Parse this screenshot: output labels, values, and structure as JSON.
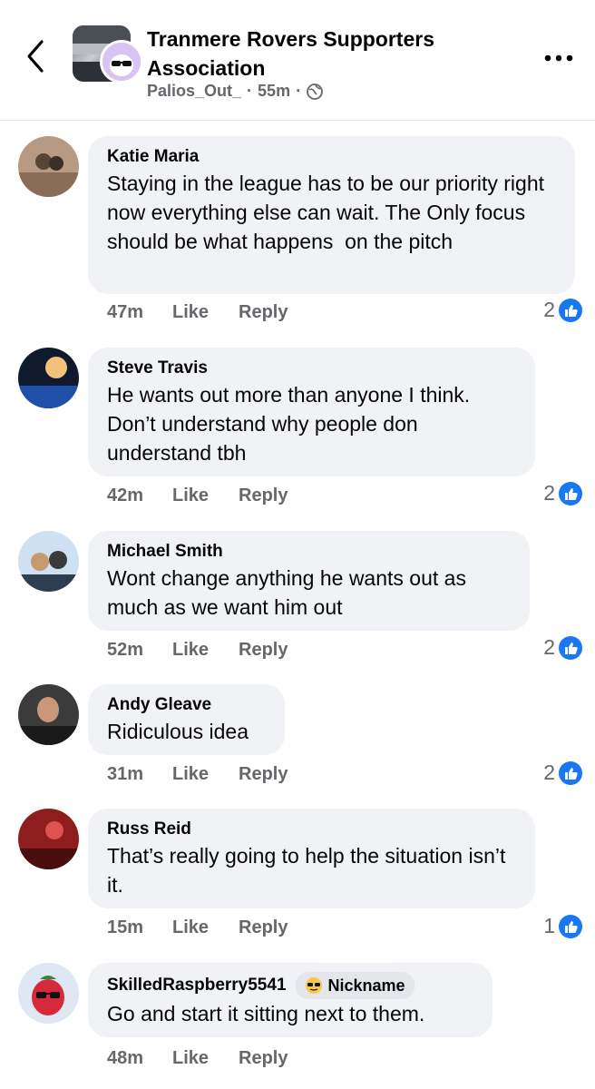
{
  "header": {
    "group_name": "Tranmere Rovers Supporters Association",
    "author": "Palios_Out_",
    "separator": "·",
    "time": "55m",
    "audience_icon": "globe-icon"
  },
  "colors": {
    "accent": "#1877f2",
    "bubble": "#f0f2f5",
    "secondary_text": "#65676b"
  },
  "actions": {
    "like_label": "Like",
    "reply_label": "Reply"
  },
  "comments": [
    {
      "author": "Katie Maria",
      "text": "Staying in the league has to be our priority right now everything else can wait. The Only focus should be what happens  on the pitch",
      "time": "47m",
      "reactions": "2"
    },
    {
      "author": "Steve Travis",
      "text": "He wants out more than anyone I think. Don’t understand why people don understand tbh",
      "time": "42m",
      "reactions": "2"
    },
    {
      "author": "Michael Smith",
      "text": "Wont change anything he wants out as much as we want him out",
      "time": "52m",
      "reactions": "2"
    },
    {
      "author": "Andy Gleave",
      "text": "Ridiculous idea",
      "time": "31m",
      "reactions": "2"
    },
    {
      "author": "Russ Reid",
      "text": "That’s really going to help the situation isn’t it.",
      "time": "15m",
      "reactions": "1"
    },
    {
      "author": "SkilledRaspberry5541",
      "badge": "Nickname",
      "text": "Go and start it sitting next to them.",
      "time": "48m",
      "reactions": ""
    }
  ]
}
